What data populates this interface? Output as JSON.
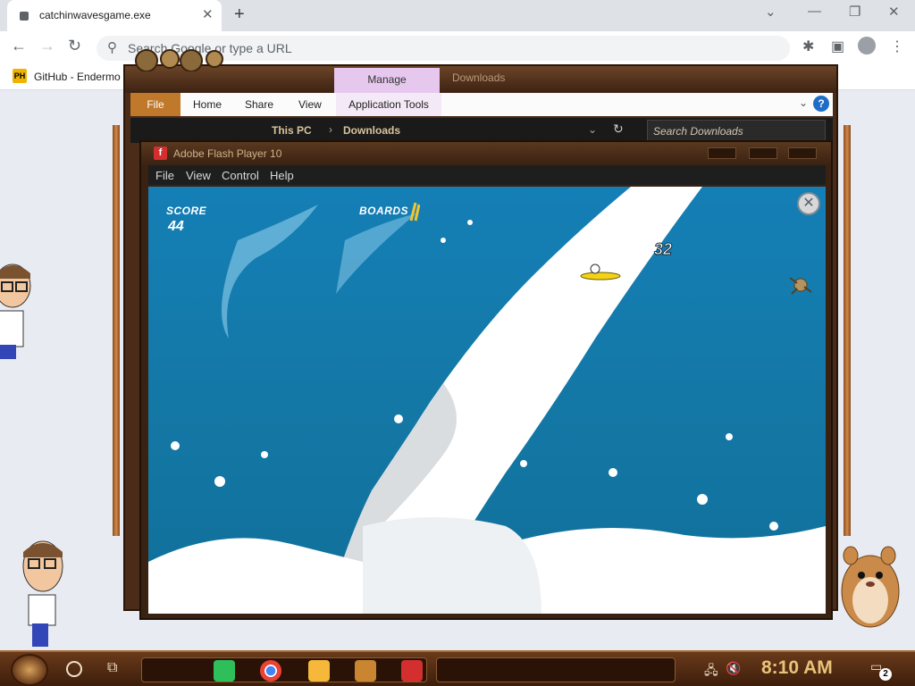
{
  "browser": {
    "tab_title": "catchinwavesgame.exe",
    "new_tab_symbol": "+",
    "omnibox_placeholder": "Search Google or type a URL",
    "bookmark_label": "GitHub - Endermo",
    "bookmark_icon_text": "PH"
  },
  "explorer": {
    "manage_label": "Manage",
    "ghost_title": "Downloads",
    "ribbon": {
      "file": "File",
      "home": "Home",
      "share": "Share",
      "view": "View",
      "app_tools": "Application Tools"
    },
    "address": {
      "this_pc": "This PC",
      "separator": "›",
      "downloads": "Downloads"
    },
    "search_placeholder": "Search Downloads"
  },
  "flash": {
    "window_title": "Adobe Flash Player 10",
    "menu": [
      "File",
      "View",
      "Control",
      "Help"
    ]
  },
  "game": {
    "score_label": "SCORE",
    "score_value": "44",
    "boards_label": "BOARDS",
    "combo_value": "32",
    "close_symbol": "✕"
  },
  "taskbar": {
    "clock": "8:10 AM",
    "notification_count": "2"
  },
  "colors": {
    "ocean": "#1478a6",
    "wave": "#ffffff",
    "taskbar": "#4a2612",
    "clock": "#e9c27a",
    "manage_tab": "#e6c8ef"
  },
  "icons": [
    "search-icon",
    "extensions-icon",
    "sidepanel-icon",
    "profile-icon",
    "menu-icon",
    "help-icon",
    "refresh-icon",
    "flash-icon",
    "start-icon",
    "cortana-icon",
    "taskview-icon",
    "chrome-icon",
    "folder-icon",
    "notes-icon",
    "network-icon",
    "volume-muted-icon",
    "notification-icon"
  ]
}
